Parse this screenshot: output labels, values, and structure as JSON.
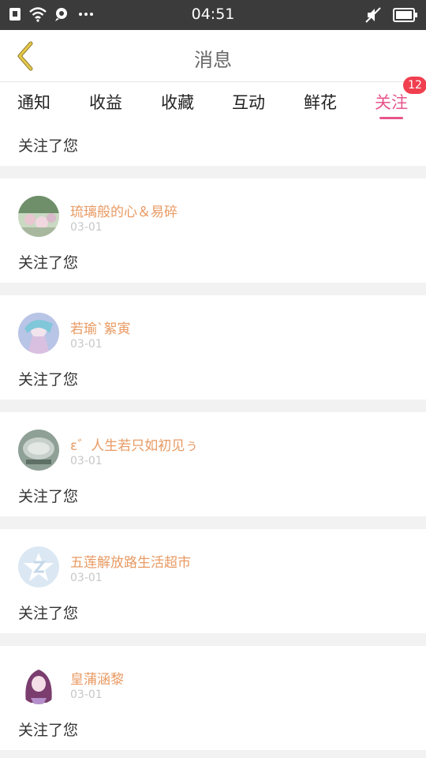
{
  "status_bar": {
    "time": "04:51",
    "icons": [
      "sim-icon",
      "wifi-icon",
      "notification-icon",
      "more-dots-icon",
      "muted-icon",
      "battery-icon"
    ]
  },
  "header": {
    "title": "消息",
    "back_icon": "chevron-left-icon"
  },
  "tabs": [
    {
      "label": "通知",
      "active": false
    },
    {
      "label": "收益",
      "active": false
    },
    {
      "label": "收藏",
      "active": false
    },
    {
      "label": "互动",
      "active": false
    },
    {
      "label": "鲜花",
      "active": false
    },
    {
      "label": "关注",
      "active": true,
      "badge": "12"
    }
  ],
  "list": {
    "first_action": "关注了您",
    "items": [
      {
        "username": "琉璃般的心＆易碎",
        "date": "03-01",
        "action": "关注了您"
      },
      {
        "username": "若瑜`絮寅",
        "date": "03-01",
        "action": "关注了您"
      },
      {
        "username": "ε゛人生若只如初见ぅ",
        "date": "03-01",
        "action": "关注了您"
      },
      {
        "username": "五莲解放路生活超市",
        "date": "03-01",
        "action": "关注了您"
      },
      {
        "username": "皇蒲涵黎",
        "date": "03-01",
        "action": "关注了您"
      }
    ]
  },
  "colors": {
    "accent": "#e8558c",
    "username": "#e89a63",
    "badge": "#f03f4f",
    "status_bar": "#3b3b3b"
  }
}
